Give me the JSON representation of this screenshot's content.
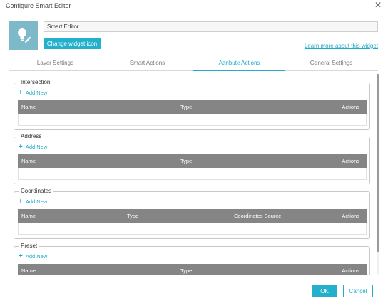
{
  "dialog": {
    "title": "Configure Smart Editor",
    "close_icon": "close-icon"
  },
  "widget": {
    "icon": "pencil-lightbulb-icon",
    "icon_bg_color": "#7db9c9",
    "name_value": "Smart Editor",
    "change_icon_label": "Change widget icon",
    "learn_more_label": "Learn more about this widget"
  },
  "tabs": [
    {
      "label": "Layer Settings",
      "active": false
    },
    {
      "label": "Smart Actions",
      "active": false
    },
    {
      "label": "Attribute Actions",
      "active": true
    },
    {
      "label": "General Settings",
      "active": false
    }
  ],
  "sections": [
    {
      "legend": "Intersection",
      "add_label": "Add New",
      "columns": [
        "Name",
        "Type",
        "Actions"
      ]
    },
    {
      "legend": "Address",
      "add_label": "Add New",
      "columns": [
        "Name",
        "Type",
        "Actions"
      ]
    },
    {
      "legend": "Coordinates",
      "add_label": "Add New",
      "columns": [
        "Name",
        "Type",
        "Coordinates Source",
        "Actions"
      ]
    },
    {
      "legend": "Preset",
      "add_label": "Add New",
      "columns": [
        "Name",
        "Type",
        "Actions"
      ]
    }
  ],
  "footer": {
    "ok_label": "OK",
    "cancel_label": "Cancel"
  },
  "colors": {
    "accent": "#24b0cc",
    "table_header": "#858585"
  }
}
